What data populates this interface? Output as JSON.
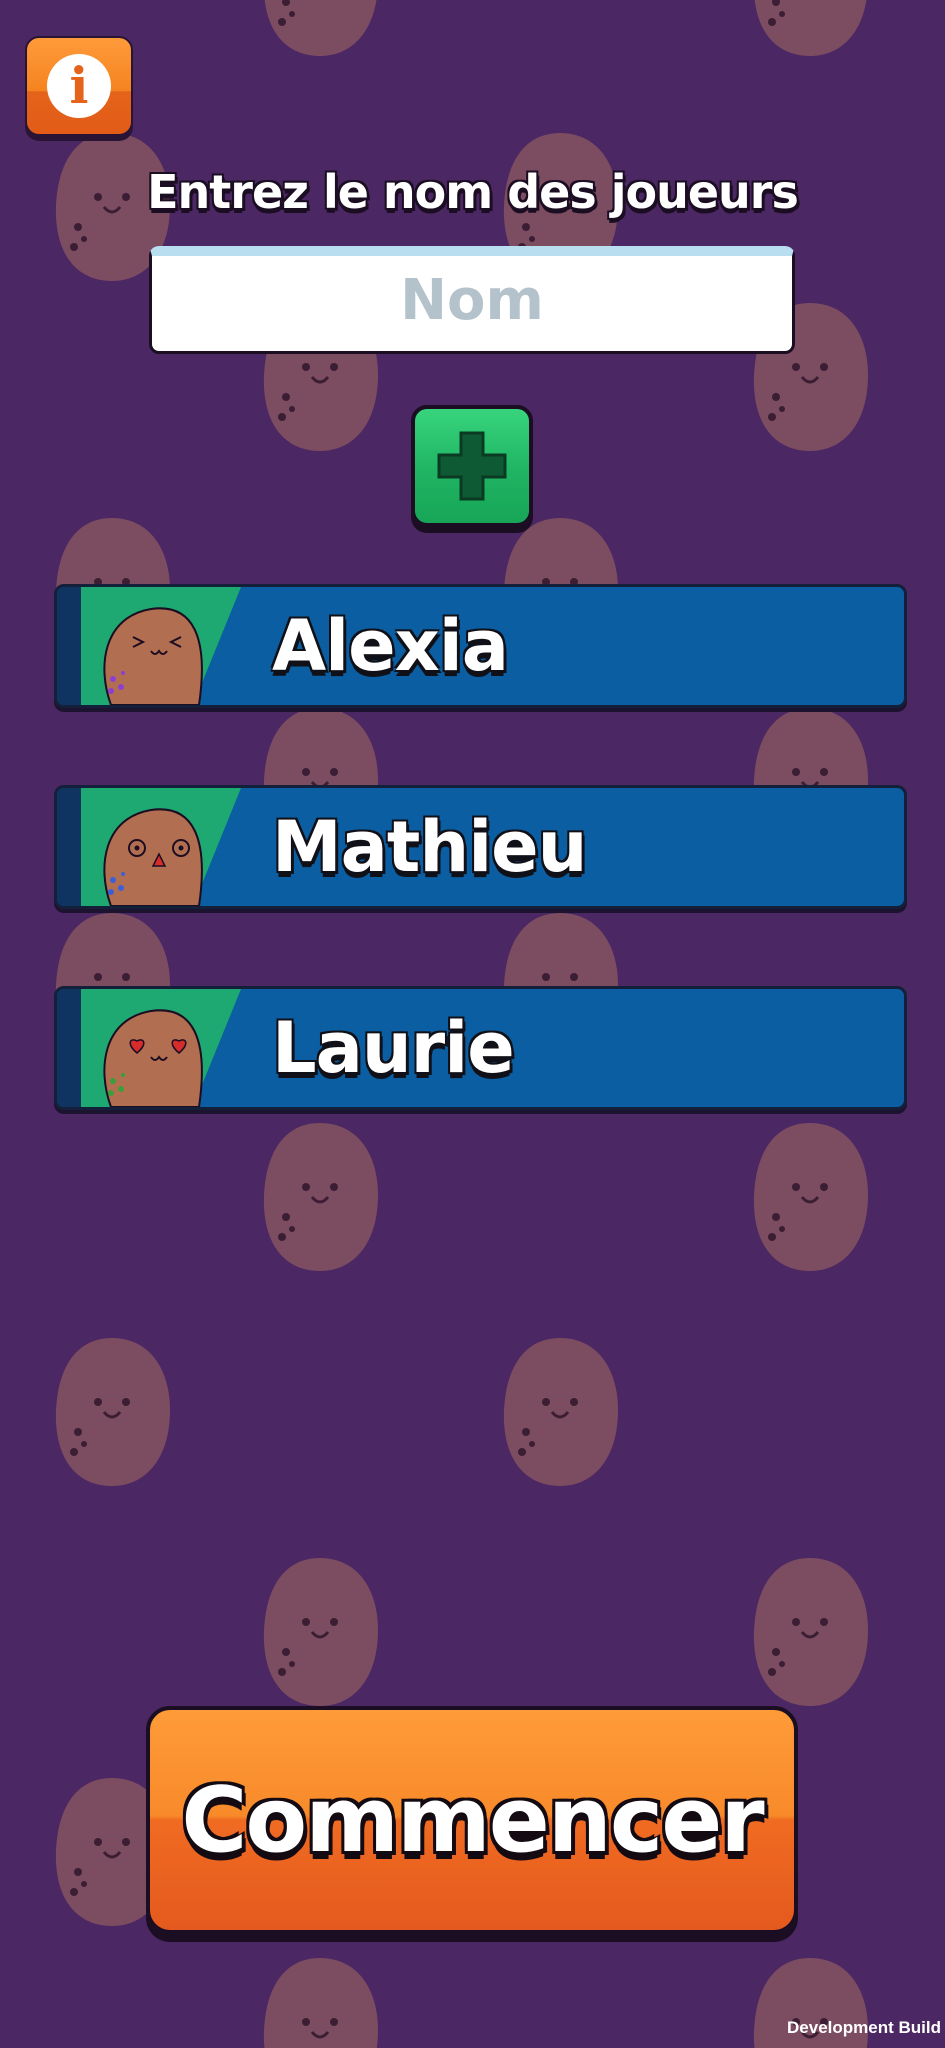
{
  "header": {
    "info_button": {
      "icon": "info-icon",
      "glyph": "i"
    },
    "title": "Entrez le nom des joueurs"
  },
  "name_input": {
    "placeholder": "Nom",
    "value": ""
  },
  "add_button": {
    "icon": "plus-icon"
  },
  "players": [
    {
      "name": "Alexia",
      "avatar": "potato-squint-face"
    },
    {
      "name": "Mathieu",
      "avatar": "potato-surprised-face"
    },
    {
      "name": "Laurie",
      "avatar": "potato-heart-eyes-face"
    }
  ],
  "start_button": {
    "label": "Commencer"
  },
  "footer": {
    "build_label": "Development Build"
  },
  "colors": {
    "background": "#4b2763",
    "orange_button": "#f58420",
    "green_button": "#1fb463",
    "player_row": "#0b5ea1",
    "avatar_bg": "#1fa972"
  }
}
